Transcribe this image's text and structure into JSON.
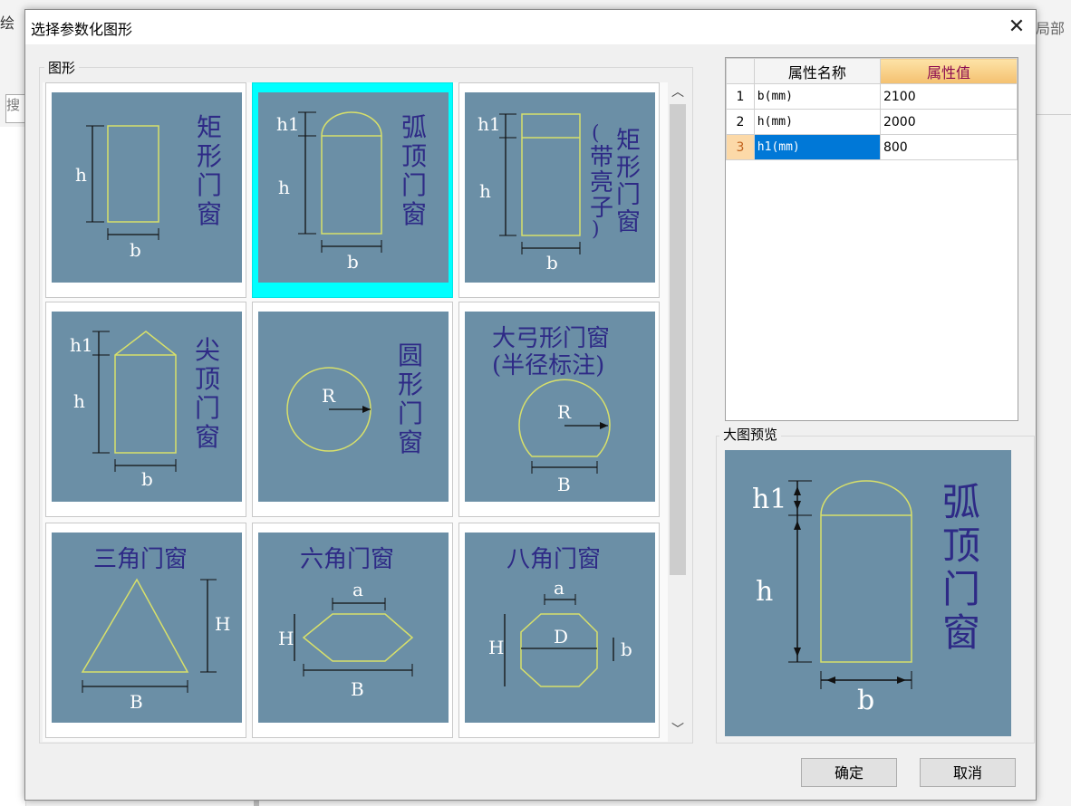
{
  "background": {
    "title_left": "绘",
    "title_right": "局部",
    "search_label": "搜"
  },
  "dialog": {
    "title": "选择参数化图形",
    "close_icon": "close-icon",
    "shapes_group_label": "图形",
    "preview_group_label": "大图预览",
    "ok_label": "确定",
    "cancel_label": "取消"
  },
  "shapes": [
    {
      "name": "矩形门窗",
      "selected": false
    },
    {
      "name": "弧顶门窗",
      "selected": true
    },
    {
      "name": "矩形门窗(带亮子)",
      "selected": false
    },
    {
      "name": "尖顶门窗",
      "selected": false
    },
    {
      "name": "圆形门窗",
      "selected": false
    },
    {
      "name": "大弓形门窗(半径标注)",
      "selected": false
    },
    {
      "name": "三角门窗",
      "selected": false
    },
    {
      "name": "六角门窗",
      "selected": false
    },
    {
      "name": "八角门窗",
      "selected": false
    }
  ],
  "properties": {
    "header_name": "属性名称",
    "header_value": "属性值",
    "rows": [
      {
        "index": "1",
        "name": "b(mm)",
        "value": "2100"
      },
      {
        "index": "2",
        "name": "h(mm)",
        "value": "2000"
      },
      {
        "index": "3",
        "name": "h1(mm)",
        "value": "800"
      }
    ],
    "active_row": 3
  },
  "colors": {
    "tile_bg": "#6b8fa6",
    "shape_stroke": "#d8e06a",
    "label_text": "#2e2a86",
    "selection": "#00ffff"
  }
}
